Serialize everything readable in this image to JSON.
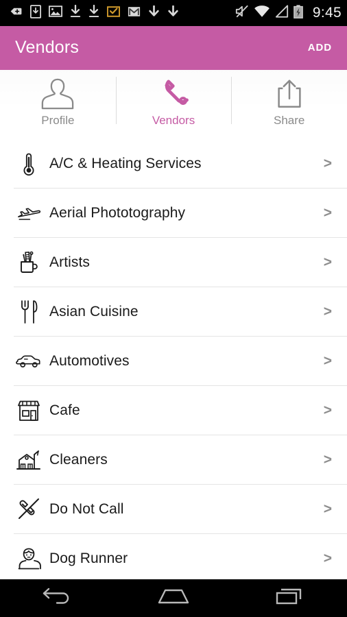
{
  "statusbar": {
    "time": "9:45",
    "left_icons": [
      {
        "name": "app-install-tag-icon"
      },
      {
        "name": "download-to-device-icon"
      },
      {
        "name": "image-download-icon"
      },
      {
        "name": "download-arrow-icon"
      },
      {
        "name": "download-arrow-icon-2"
      },
      {
        "name": "email-check-icon"
      },
      {
        "name": "gmail-icon"
      },
      {
        "name": "download-arrow-icon-3"
      },
      {
        "name": "download-arrow-icon-4"
      }
    ],
    "right_icons": [
      {
        "name": "volume-muted-icon"
      },
      {
        "name": "wifi-icon"
      },
      {
        "name": "cell-signal-icon"
      },
      {
        "name": "battery-charging-icon"
      }
    ]
  },
  "actionbar": {
    "title": "Vendors",
    "add_label": "ADD",
    "background": "#c55ba4"
  },
  "tabs": [
    {
      "label": "Profile",
      "icon": "profile-icon",
      "active": false
    },
    {
      "label": "Vendors",
      "icon": "wrench-icon",
      "active": true
    },
    {
      "label": "Share",
      "icon": "share-icon",
      "active": false
    }
  ],
  "list": {
    "chevron": ">",
    "items": [
      {
        "label": "A/C & Heating Services",
        "icon": "thermometer-icon"
      },
      {
        "label": "Aerial Phototography",
        "icon": "airplane-icon"
      },
      {
        "label": "Artists",
        "icon": "pencil-cup-icon"
      },
      {
        "label": "Asian Cuisine",
        "icon": "fork-knife-icon"
      },
      {
        "label": "Automotives",
        "icon": "car-icon"
      },
      {
        "label": "Cafe",
        "icon": "storefront-icon"
      },
      {
        "label": "Cleaners",
        "icon": "house-icon"
      },
      {
        "label": "Do Not Call",
        "icon": "phone-crossed-icon"
      },
      {
        "label": "Dog Runner",
        "icon": "person-bust-icon"
      }
    ]
  },
  "navbar": {
    "buttons": [
      {
        "name": "back-button",
        "icon": "back-arrow-icon"
      },
      {
        "name": "home-button",
        "icon": "home-icon"
      },
      {
        "name": "recents-button",
        "icon": "recent-apps-icon"
      }
    ]
  }
}
